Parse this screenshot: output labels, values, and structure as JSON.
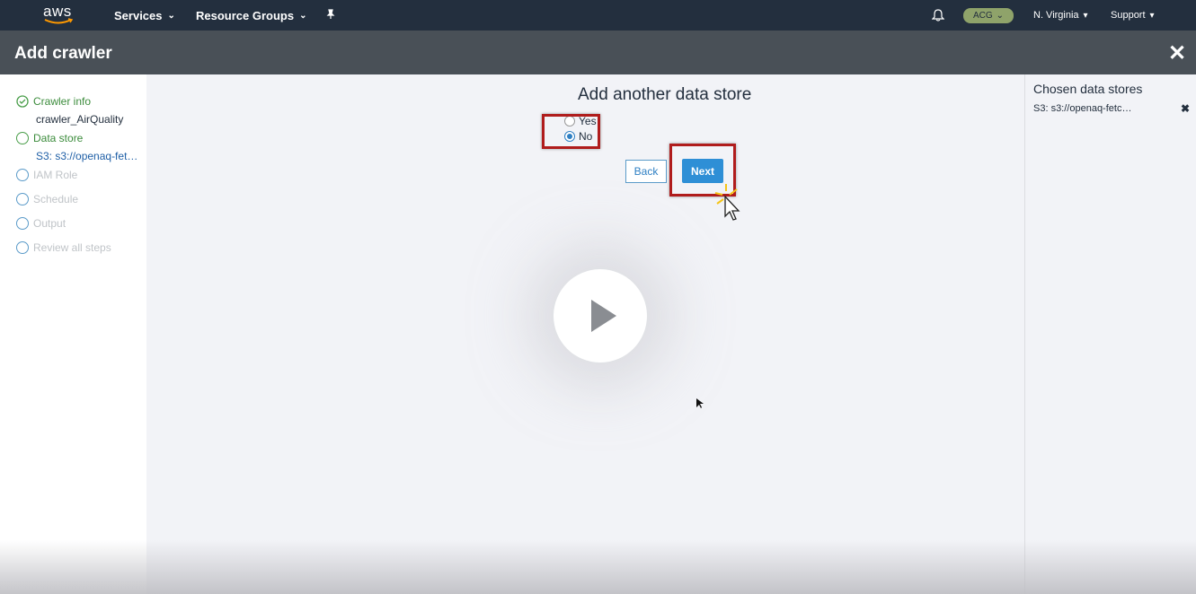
{
  "topnav": {
    "logo": "aws",
    "services": "Services",
    "resource_groups": "Resource Groups",
    "account": "ACG",
    "region": "N. Virginia",
    "support": "Support"
  },
  "header": {
    "title": "Add crawler"
  },
  "steps": [
    {
      "label": "Crawler info",
      "sub": "crawler_AirQuality"
    },
    {
      "label": "Data store",
      "sub": "S3: s3://openaq-fet…"
    },
    {
      "label": "IAM Role"
    },
    {
      "label": "Schedule"
    },
    {
      "label": "Output"
    },
    {
      "label": "Review all steps"
    }
  ],
  "main": {
    "title": "Add another data store",
    "option_yes": "Yes",
    "option_no": "No",
    "selected": "No",
    "back_label": "Back",
    "next_label": "Next"
  },
  "right_panel": {
    "title": "Chosen data stores",
    "item": "S3: s3://openaq-fetc…"
  },
  "colors": {
    "nav_bg": "#232f3e",
    "header_bg": "#495057",
    "accent": "#2e8fd6",
    "success": "#3c8c3c",
    "highlight": "#b01c1c"
  }
}
